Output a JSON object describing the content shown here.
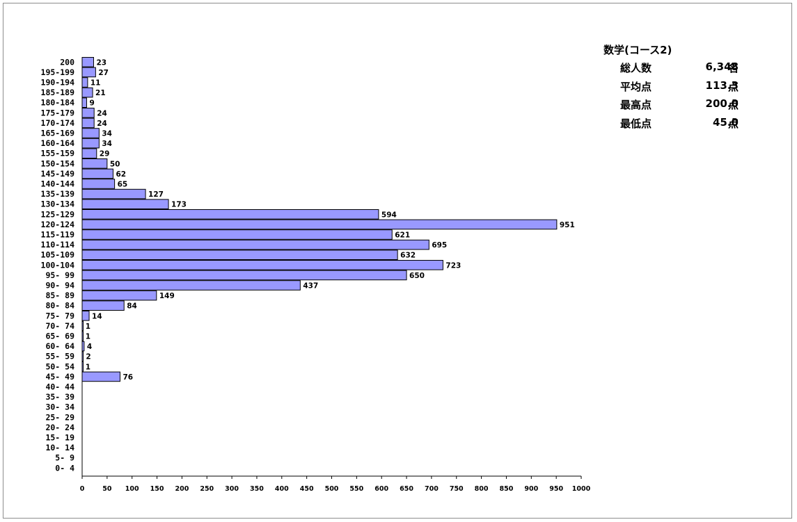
{
  "stats": {
    "title": "数学(コース2)",
    "rows": [
      {
        "label": "総人数",
        "value": "6,348",
        "unit": "名"
      },
      {
        "label": "平均点",
        "value": "113.3",
        "unit": "点"
      },
      {
        "label": "最高点",
        "value": "200.0",
        "unit": "点"
      },
      {
        "label": "最低点",
        "value": "45.0",
        "unit": "点"
      }
    ]
  },
  "colors": {
    "bar_fill": "#9999ff",
    "bar_stroke": "#000000",
    "axis": "#000000"
  },
  "chart_data": {
    "type": "bar",
    "orientation": "horizontal",
    "categories": [
      "200",
      "195-199",
      "190-194",
      "185-189",
      "180-184",
      "175-179",
      "170-174",
      "165-169",
      "160-164",
      "155-159",
      "150-154",
      "145-149",
      "140-144",
      "135-139",
      "130-134",
      "125-129",
      "120-124",
      "115-119",
      "110-114",
      "105-109",
      "100-104",
      "95- 99",
      "90- 94",
      "85- 89",
      "80- 84",
      "75- 79",
      "70- 74",
      "65- 69",
      "60- 64",
      "55- 59",
      "50- 54",
      "45- 49",
      "40- 44",
      "35- 39",
      "30- 34",
      "25- 29",
      "20- 24",
      "15- 19",
      "10- 14",
      "5- 9",
      "0- 4"
    ],
    "values": [
      23,
      27,
      11,
      21,
      9,
      24,
      24,
      34,
      34,
      29,
      50,
      62,
      65,
      127,
      173,
      594,
      951,
      621,
      695,
      632,
      723,
      650,
      437,
      149,
      84,
      14,
      1,
      1,
      4,
      2,
      1,
      76,
      0,
      0,
      0,
      0,
      0,
      0,
      0,
      0,
      0
    ],
    "xlim": [
      0,
      1000
    ],
    "xticks": [
      0,
      50,
      100,
      150,
      200,
      250,
      300,
      350,
      400,
      450,
      500,
      550,
      600,
      650,
      700,
      750,
      800,
      850,
      900,
      950,
      1000
    ],
    "data_labels": true,
    "grid": false,
    "legend": "none"
  }
}
